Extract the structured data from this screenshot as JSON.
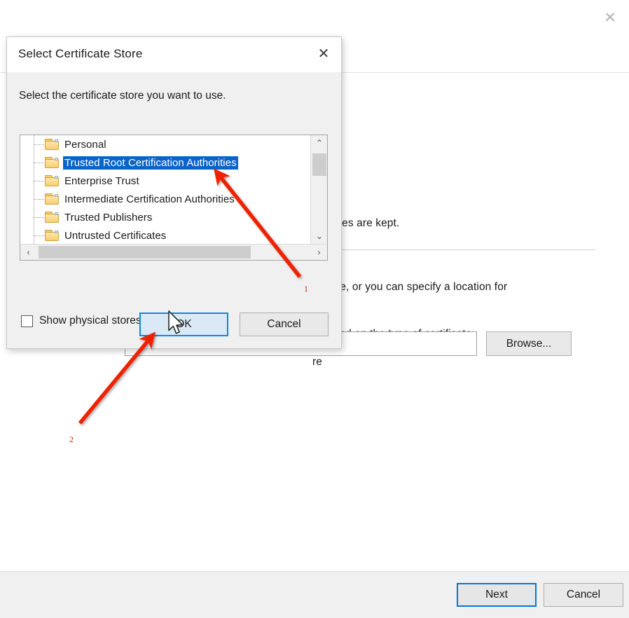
{
  "background_window": {
    "close_icon": "✕",
    "text_fragments": {
      "line_kept": "rtificates are kept.",
      "line_store": "e store, or you can specify a location for",
      "line_based": "e based on the type of certificate",
      "line_re": "re"
    },
    "path_input": {
      "value": "",
      "placeholder": ""
    },
    "browse_button": "Browse...",
    "footer": {
      "next_label": "Next",
      "cancel_label": "Cancel"
    }
  },
  "dialog": {
    "title": "Select Certificate Store",
    "close_icon": "✕",
    "prompt": "Select the certificate store you want to use.",
    "stores": [
      {
        "label": "Personal",
        "selected": false,
        "clipped": false
      },
      {
        "label": "Trusted Root Certification Authorities",
        "selected": true,
        "clipped": false
      },
      {
        "label": "Enterprise Trust",
        "selected": false,
        "clipped": false
      },
      {
        "label": "Intermediate Certification Authorities",
        "selected": false,
        "clipped": false
      },
      {
        "label": "Trusted Publishers",
        "selected": false,
        "clipped": false
      },
      {
        "label": "Untrusted Certificates",
        "selected": false,
        "clipped": true
      }
    ],
    "scrollbars": {
      "up_arrow": "⌃",
      "down_arrow": "⌄",
      "left_arrow": "‹",
      "right_arrow": "›"
    },
    "show_physical_stores": {
      "label": "Show physical stores",
      "checked": false
    },
    "ok_label": "OK",
    "cancel_label": "Cancel"
  },
  "annotations": {
    "accent_color": "#ee2200",
    "steps": [
      {
        "number": "1",
        "target": "selected-store-item"
      },
      {
        "number": "2",
        "target": "dialog-ok-button"
      }
    ]
  }
}
